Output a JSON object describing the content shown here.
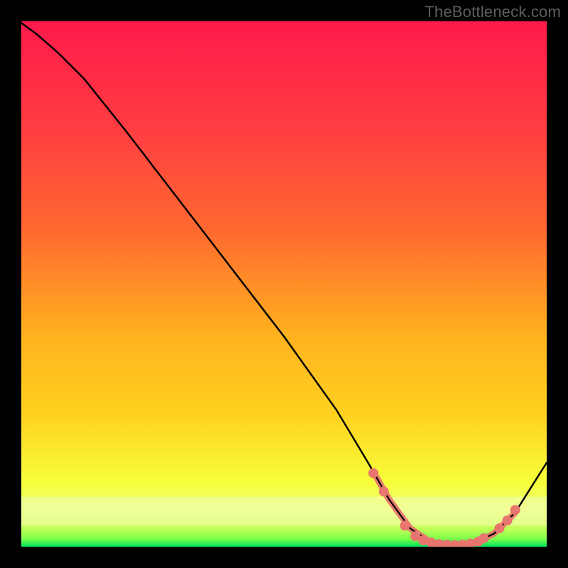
{
  "watermark": "TheBottleneck.com",
  "chart_data": {
    "type": "line",
    "title": "",
    "xlabel": "",
    "ylabel": "",
    "xlim": [
      0,
      100
    ],
    "ylim": [
      0,
      100
    ],
    "grid": false,
    "legend": false,
    "gradient_colors": {
      "top": "#ff1a4b",
      "upper_mid": "#ff6a2f",
      "mid": "#ffd21f",
      "lower_mid": "#f6ff3a",
      "band": "#eaff7a",
      "bottom": "#00e05a"
    },
    "curve": {
      "x": [
        0,
        3,
        7,
        12,
        20,
        30,
        40,
        50,
        60,
        66,
        70,
        74,
        78,
        82,
        86,
        90,
        94,
        100
      ],
      "y": [
        99.7,
        97.5,
        94.0,
        89.0,
        79.0,
        66.0,
        53.0,
        40.0,
        26.0,
        16.0,
        9.0,
        3.5,
        0.8,
        0.3,
        0.6,
        2.5,
        6.5,
        16.0
      ]
    },
    "markers": {
      "color": "#e8766f",
      "points": [
        {
          "x": 67,
          "y": 14.0
        },
        {
          "x": 69,
          "y": 10.5
        },
        {
          "x": 73,
          "y": 4.0
        },
        {
          "x": 75,
          "y": 2.0
        },
        {
          "x": 76.5,
          "y": 1.2
        },
        {
          "x": 78,
          "y": 0.8
        },
        {
          "x": 79.5,
          "y": 0.5
        },
        {
          "x": 81,
          "y": 0.4
        },
        {
          "x": 82.5,
          "y": 0.3
        },
        {
          "x": 84,
          "y": 0.4
        },
        {
          "x": 85.5,
          "y": 0.6
        },
        {
          "x": 87,
          "y": 1.0
        },
        {
          "x": 88,
          "y": 1.6
        },
        {
          "x": 91,
          "y": 3.5
        },
        {
          "x": 92.5,
          "y": 5.0
        },
        {
          "x": 94,
          "y": 7.0
        }
      ]
    }
  }
}
